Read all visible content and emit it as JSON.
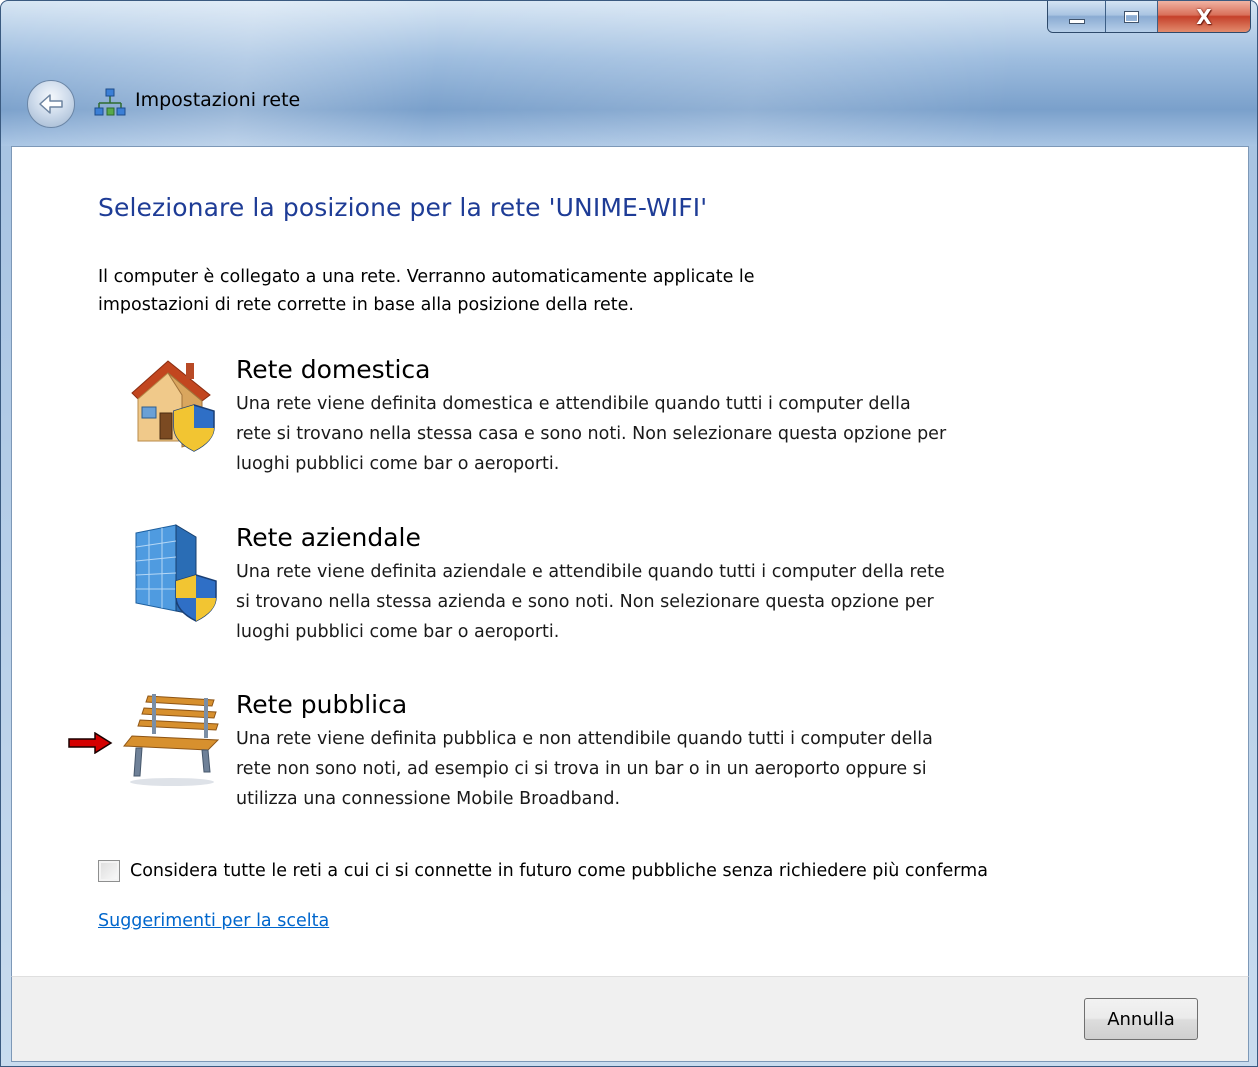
{
  "window": {
    "title": "Impostazioni rete",
    "caption_close_glyph": "X"
  },
  "main": {
    "heading": "Selezionare la posizione per la rete 'UNIME-WIFI'",
    "intro_line1": "Il computer è collegato a una rete. Verranno automaticamente applicate le",
    "intro_line2": "impostazioni di rete corrette in base alla posizione della rete."
  },
  "options": [
    {
      "icon": "home-network-icon",
      "title": "Rete domestica",
      "desc_line1": "Una rete viene definita domestica e attendibile quando tutti i computer della",
      "desc_line2": "rete si trovano nella stessa casa e sono noti. Non selezionare questa opzione per",
      "desc_line3": "luoghi pubblici come bar o aeroporti."
    },
    {
      "icon": "work-network-icon",
      "title": "Rete aziendale",
      "desc_line1": "Una rete viene definita aziendale e attendibile quando tutti i computer della rete",
      "desc_line2": "si trovano nella stessa azienda e sono noti. Non selezionare questa opzione per",
      "desc_line3": "luoghi pubblici come bar o aeroporti."
    },
    {
      "icon": "public-network-icon",
      "title": "Rete pubblica",
      "desc_line1": "Una rete viene definita pubblica e non attendibile quando tutti i computer della",
      "desc_line2": "rete non sono noti, ad esempio ci si trova in un bar o in un aeroporto oppure si",
      "desc_line3": "utilizza una connessione Mobile Broadband."
    }
  ],
  "checkbox": {
    "label": "Considera tutte le reti a cui ci si connette in futuro come pubbliche senza richiedere più conferma",
    "checked": false
  },
  "help_link": "Suggerimenti per la scelta",
  "footer": {
    "cancel_label": "Annulla"
  },
  "colors": {
    "heading": "#1e3c96",
    "link": "#0066cc",
    "arrow": "#d40000"
  }
}
